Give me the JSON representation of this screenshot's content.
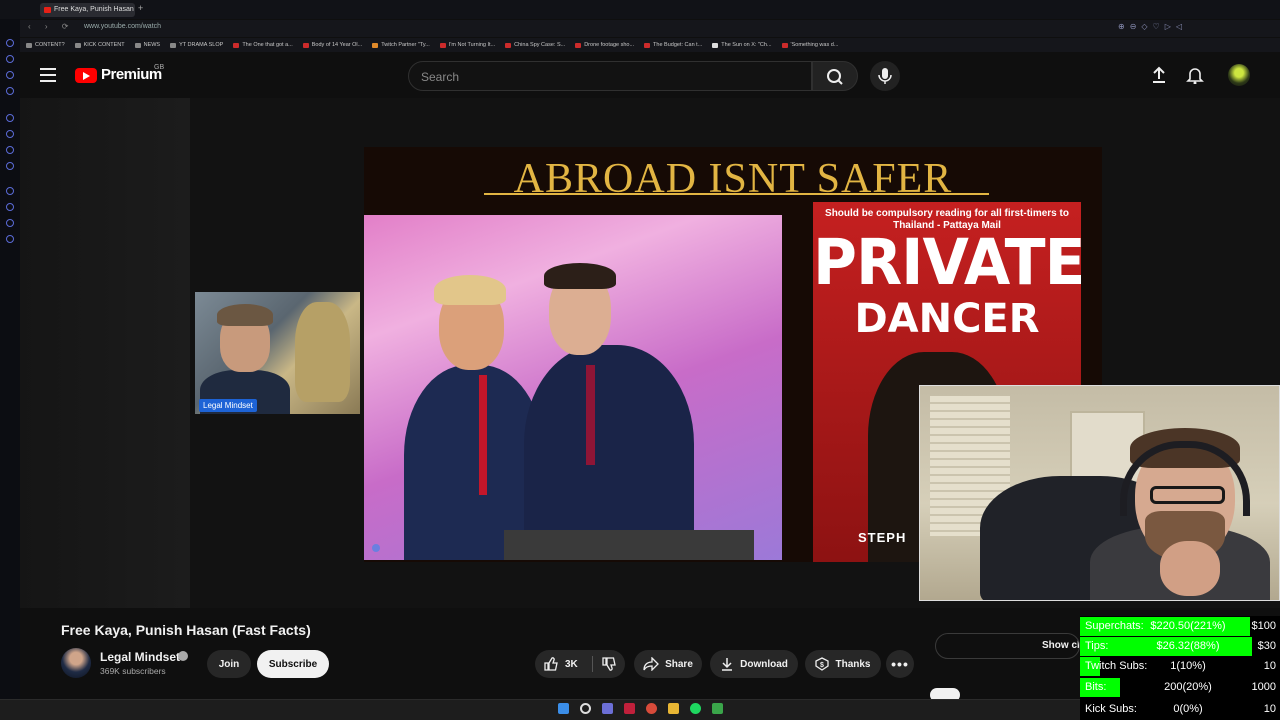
{
  "browser": {
    "tab_title": "Free Kaya, Punish Hasan",
    "new_tab": "+",
    "address": "www.youtube.com/watch",
    "bookmarks": [
      "CONTENT?",
      "KICK CONTENT",
      "NEWS",
      "YT DRAMA SLOP",
      "The One that got a...",
      "Body of 14 Year Ol...",
      "Twitch Partner \"Ty...",
      "I'm Not Turning It...",
      "China Spy Case: S...",
      "Drone footage sho...",
      "The Budget: Can t...",
      "The Sun on X: \"Ch...",
      "'Something was d..."
    ]
  },
  "header": {
    "logo_text": "Premium",
    "region": "GB",
    "search_placeholder": "Search"
  },
  "player": {
    "guest_label": "Legal Mindset",
    "thumb_title": "ABROAD ISNT SAFER",
    "book_quote": "Should be compulsory reading for all first-timers to Thailand - Pattaya Mail",
    "book_title": "PRIVATE",
    "book_subtitle": "DANCER",
    "book_author": "STEPH"
  },
  "video": {
    "title": "Free Kaya, Punish Hasan (Fast Facts)",
    "channel": "Legal Mindset",
    "subscribers": "369K subscribers",
    "join_label": "Join",
    "subscribe_label": "Subscribe",
    "likes": "3K",
    "share_label": "Share",
    "download_label": "Download",
    "thanks_label": "Thanks",
    "show_chat_label": "Show ch"
  },
  "overlay": {
    "rows": [
      {
        "label": "Superchats:",
        "value": "$220.50(221%)",
        "goal": "$100",
        "fill": 0.85
      },
      {
        "label": "Tips:",
        "value": "$26.32(88%)",
        "goal": "$30",
        "fill": 0.86
      },
      {
        "label": "Twitch Subs:",
        "value": "1(10%)",
        "goal": "10",
        "fill": 0.1
      },
      {
        "label": "Bits:",
        "value": "200(20%)",
        "goal": "1000",
        "fill": 0.2
      },
      {
        "label": "Kick Subs:",
        "value": "0(0%)",
        "goal": "10",
        "fill": 0
      }
    ]
  },
  "colors": {
    "youtube_red": "#ff0000",
    "overlay_green": "#00ff00",
    "thumb_gold": "#e2b543"
  }
}
